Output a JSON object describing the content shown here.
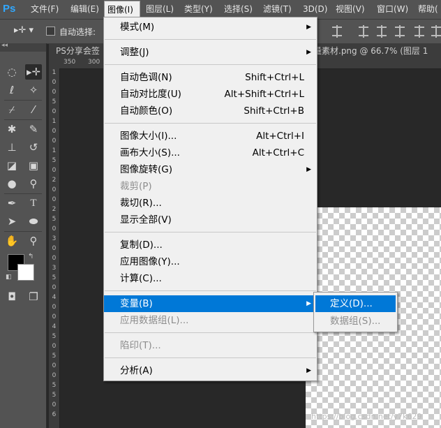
{
  "app": {
    "logo": "Ps"
  },
  "menubar": [
    {
      "label": "文件(F)"
    },
    {
      "label": "编辑(E)"
    },
    {
      "label": "图像(I)",
      "active": true
    },
    {
      "label": "图层(L)"
    },
    {
      "label": "类型(Y)"
    },
    {
      "label": "选择(S)"
    },
    {
      "label": "滤镜(T)"
    },
    {
      "label": "3D(D)"
    },
    {
      "label": "视图(V)"
    },
    {
      "label": "窗口(W)"
    },
    {
      "label": "帮助("
    }
  ],
  "options": {
    "auto_select_label": "自动选择:"
  },
  "document": {
    "tab_left": "PS分享会签",
    "tab_right": "计矢量素材.png @ 66.7% (图层 1"
  },
  "ruler": {
    "h_labels": [
      "350",
      "300"
    ],
    "v_digits": [
      "1",
      "0",
      "0",
      "5",
      "0",
      "1",
      "0",
      "0",
      "1",
      "5",
      "0",
      "2",
      "0",
      "0",
      "2",
      "5",
      "0",
      "3",
      "0",
      "0",
      "3",
      "5",
      "0",
      "4",
      "0",
      "0",
      "4",
      "5",
      "0",
      "5",
      "0",
      "0",
      "5",
      "5",
      "0",
      "6"
    ]
  },
  "image_menu": {
    "items": [
      {
        "label": "模式(M)",
        "shortcut": "",
        "submenu": true,
        "disabled": false
      },
      {
        "label": "调整(J)",
        "shortcut": "",
        "submenu": true,
        "disabled": false
      },
      {
        "label": "自动色调(N)",
        "shortcut": "Shift+Ctrl+L",
        "submenu": false,
        "disabled": false
      },
      {
        "label": "自动对比度(U)",
        "shortcut": "Alt+Shift+Ctrl+L",
        "submenu": false,
        "disabled": false
      },
      {
        "label": "自动颜色(O)",
        "shortcut": "Shift+Ctrl+B",
        "submenu": false,
        "disabled": false
      },
      {
        "label": "图像大小(I)...",
        "shortcut": "Alt+Ctrl+I",
        "submenu": false,
        "disabled": false
      },
      {
        "label": "画布大小(S)...",
        "shortcut": "Alt+Ctrl+C",
        "submenu": false,
        "disabled": false
      },
      {
        "label": "图像旋转(G)",
        "shortcut": "",
        "submenu": true,
        "disabled": false
      },
      {
        "label": "裁剪(P)",
        "shortcut": "",
        "submenu": false,
        "disabled": true
      },
      {
        "label": "裁切(R)...",
        "shortcut": "",
        "submenu": false,
        "disabled": false
      },
      {
        "label": "显示全部(V)",
        "shortcut": "",
        "submenu": false,
        "disabled": false
      },
      {
        "label": "复制(D)...",
        "shortcut": "",
        "submenu": false,
        "disabled": false
      },
      {
        "label": "应用图像(Y)...",
        "shortcut": "",
        "submenu": false,
        "disabled": false
      },
      {
        "label": "计算(C)...",
        "shortcut": "",
        "submenu": false,
        "disabled": false
      },
      {
        "label": "变量(B)",
        "shortcut": "",
        "submenu": true,
        "disabled": false,
        "highlighted": true
      },
      {
        "label": "应用数据组(L)...",
        "shortcut": "",
        "submenu": false,
        "disabled": true
      },
      {
        "label": "陷印(T)...",
        "shortcut": "",
        "submenu": false,
        "disabled": true
      },
      {
        "label": "分析(A)",
        "shortcut": "",
        "submenu": true,
        "disabled": false
      }
    ]
  },
  "variables_submenu": {
    "items": [
      {
        "label": "定义(D)...",
        "highlighted": true,
        "disabled": false
      },
      {
        "label": "数据组(S)...",
        "highlighted": false,
        "disabled": true
      }
    ]
  },
  "watermark": "https://blog.csdn.net/y7k629",
  "colors": {
    "highlight": "#0078d7",
    "menu_bg": "#f0f0f0",
    "chrome": "#535353",
    "workspace": "#282828"
  }
}
